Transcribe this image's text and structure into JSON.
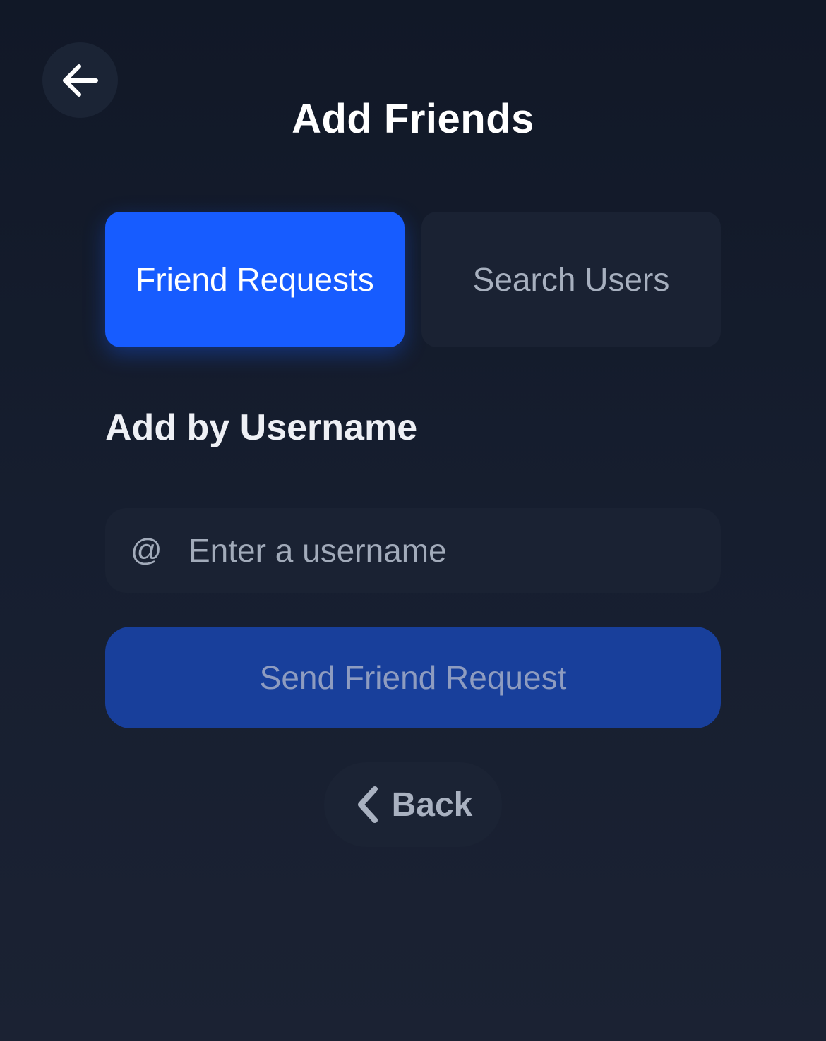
{
  "header": {
    "back_icon": "arrow-left-icon",
    "title": "Add Friends"
  },
  "tabs": [
    {
      "label": "Friend Requests",
      "active": true
    },
    {
      "label": "Search Users",
      "active": false
    }
  ],
  "add_by_username": {
    "heading": "Add by Username",
    "prefix": "@",
    "placeholder": "Enter a username",
    "value": ""
  },
  "send_button": {
    "label": "Send Friend Request"
  },
  "back_button": {
    "icon": "chevron-left-icon",
    "label": "Back"
  },
  "colors": {
    "background": "#111827",
    "accent": "#175cff",
    "send_button": "#183f9b",
    "surface": "#1a2233"
  }
}
